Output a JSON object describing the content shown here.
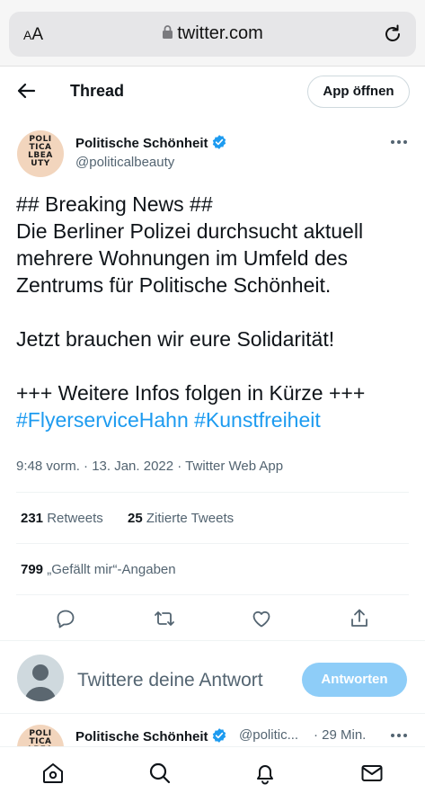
{
  "browser": {
    "aa_label_small": "A",
    "aa_label_large": "A",
    "url": "twitter.com"
  },
  "header": {
    "title": "Thread",
    "open_app_label": "App öffnen"
  },
  "tweet": {
    "author_name": "Politische Schönheit",
    "handle": "@politicalbeauty",
    "avatar_text": [
      "POLI",
      "TICA",
      "LBEA",
      "UTY"
    ],
    "lines": [
      "## Breaking News ##",
      "Die Berliner Polizei durchsucht aktuell",
      "mehrere Wohnungen im Umfeld des",
      "Zentrums für Politische Schönheit.",
      "",
      "Jetzt brauchen wir eure Solidarität!",
      "",
      "+++ Weitere Infos folgen in Kürze +++"
    ],
    "hashtags": "#FlyerserviceHahn #Kunstfreiheit",
    "meta": "9:48 vorm. · 13. Jan. 2022 · Twitter Web App",
    "retweets_count": "231",
    "retweets_label": "Retweets",
    "quotes_count": "25",
    "quotes_label": "Zitierte Tweets",
    "likes_count": "799",
    "likes_label": "„Gefällt mir“-Angaben"
  },
  "reply": {
    "placeholder": "Twittere deine Antwort",
    "button_label": "Antworten"
  },
  "next_tweet": {
    "author_name": "Politische Schönheit",
    "handle": "@politic...",
    "time": "· 29 Min."
  },
  "colors": {
    "accent": "#1d9bf0",
    "reply_button_disabled": "#8ecdf8",
    "secondary_text": "#536471"
  },
  "icons": {
    "lock": "lock-icon",
    "reload": "reload-icon",
    "back": "back-arrow-icon",
    "verified": "verified-badge-icon",
    "more": "more-dots-icon",
    "reply": "reply-icon",
    "retweet": "retweet-icon",
    "like": "heart-icon",
    "share": "share-icon",
    "home": "home-icon",
    "search": "search-icon",
    "notifications": "bell-icon",
    "messages": "mail-icon"
  }
}
